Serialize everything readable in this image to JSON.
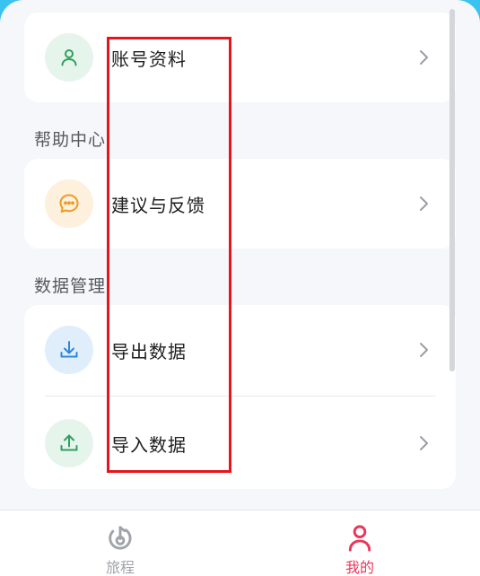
{
  "account_section": {
    "items": [
      {
        "label": "账号资料",
        "icon": "user-icon"
      }
    ]
  },
  "help_section": {
    "title": "帮助中心",
    "items": [
      {
        "label": "建议与反馈",
        "icon": "chat-bubble-icon"
      }
    ]
  },
  "data_section": {
    "title": "数据管理",
    "items": [
      {
        "label": "导出数据",
        "icon": "download-icon"
      },
      {
        "label": "导入数据",
        "icon": "upload-icon"
      }
    ]
  },
  "tabbar": {
    "tabs": [
      {
        "label": "旅程",
        "icon": "journey-icon",
        "active": false
      },
      {
        "label": "我的",
        "icon": "user-icon",
        "active": true
      }
    ]
  },
  "colors": {
    "accent": "#e8375a",
    "inactive_tab": "#a0a3a8",
    "highlight_box": "#e8141b",
    "page_bg": "#f5f7fa",
    "frame_bg": "#3ac3ee"
  }
}
